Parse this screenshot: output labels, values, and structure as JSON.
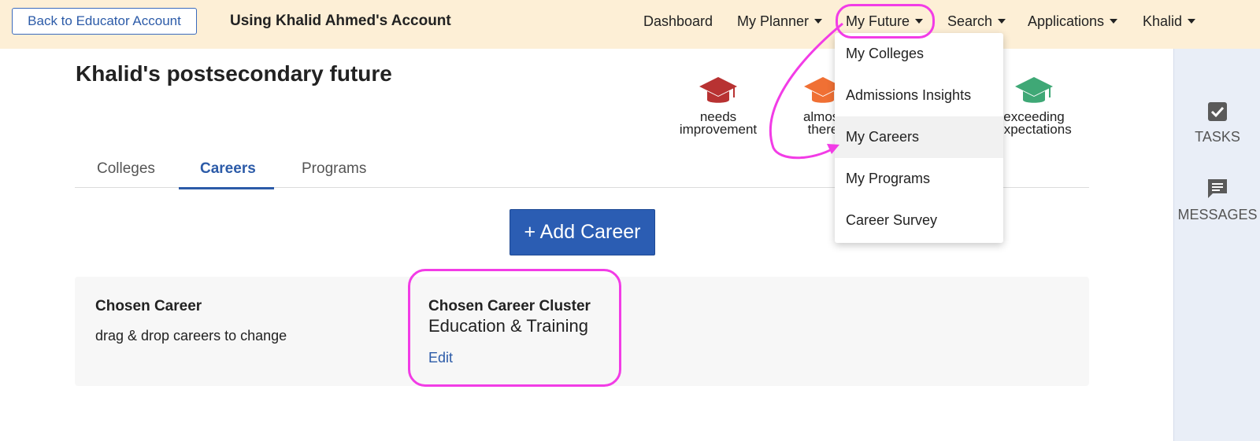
{
  "topbar": {
    "back_button": "Back to Educator Account",
    "using_account": "Using Khalid Ahmed's Account",
    "nav": {
      "dashboard": "Dashboard",
      "my_planner": "My Planner",
      "my_future": "My Future",
      "search": "Search",
      "applications": "Applications",
      "user": "Khalid"
    }
  },
  "page": {
    "title": "Khalid's postsecondary future"
  },
  "legend": [
    {
      "label_line1": "needs",
      "label_line2": "improvement",
      "color": "#b83232"
    },
    {
      "label_line1": "almost",
      "label_line2": "there",
      "color": "#f07034"
    },
    {
      "label_line1": "exceeding",
      "label_line2": "expectations",
      "color": "#3fa876"
    }
  ],
  "tabs": {
    "colleges": "Colleges",
    "careers": "Careers",
    "programs": "Programs"
  },
  "add_career_button": "+ Add Career",
  "chosen_career": {
    "label": "Chosen Career",
    "hint": "drag & drop careers to change"
  },
  "chosen_cluster": {
    "label": "Chosen Career Cluster",
    "value": "Education & Training",
    "edit": "Edit"
  },
  "dropdown": {
    "items": [
      "My Colleges",
      "Admissions Insights",
      "My Careers",
      "My Programs",
      "Career Survey"
    ]
  },
  "sidebar": {
    "tasks": "TASKS",
    "messages": "MESSAGES"
  },
  "colors": {
    "accent": "#2c5ba8",
    "topbar_bg": "#fdefd6",
    "annotation": "#f23ce6"
  }
}
